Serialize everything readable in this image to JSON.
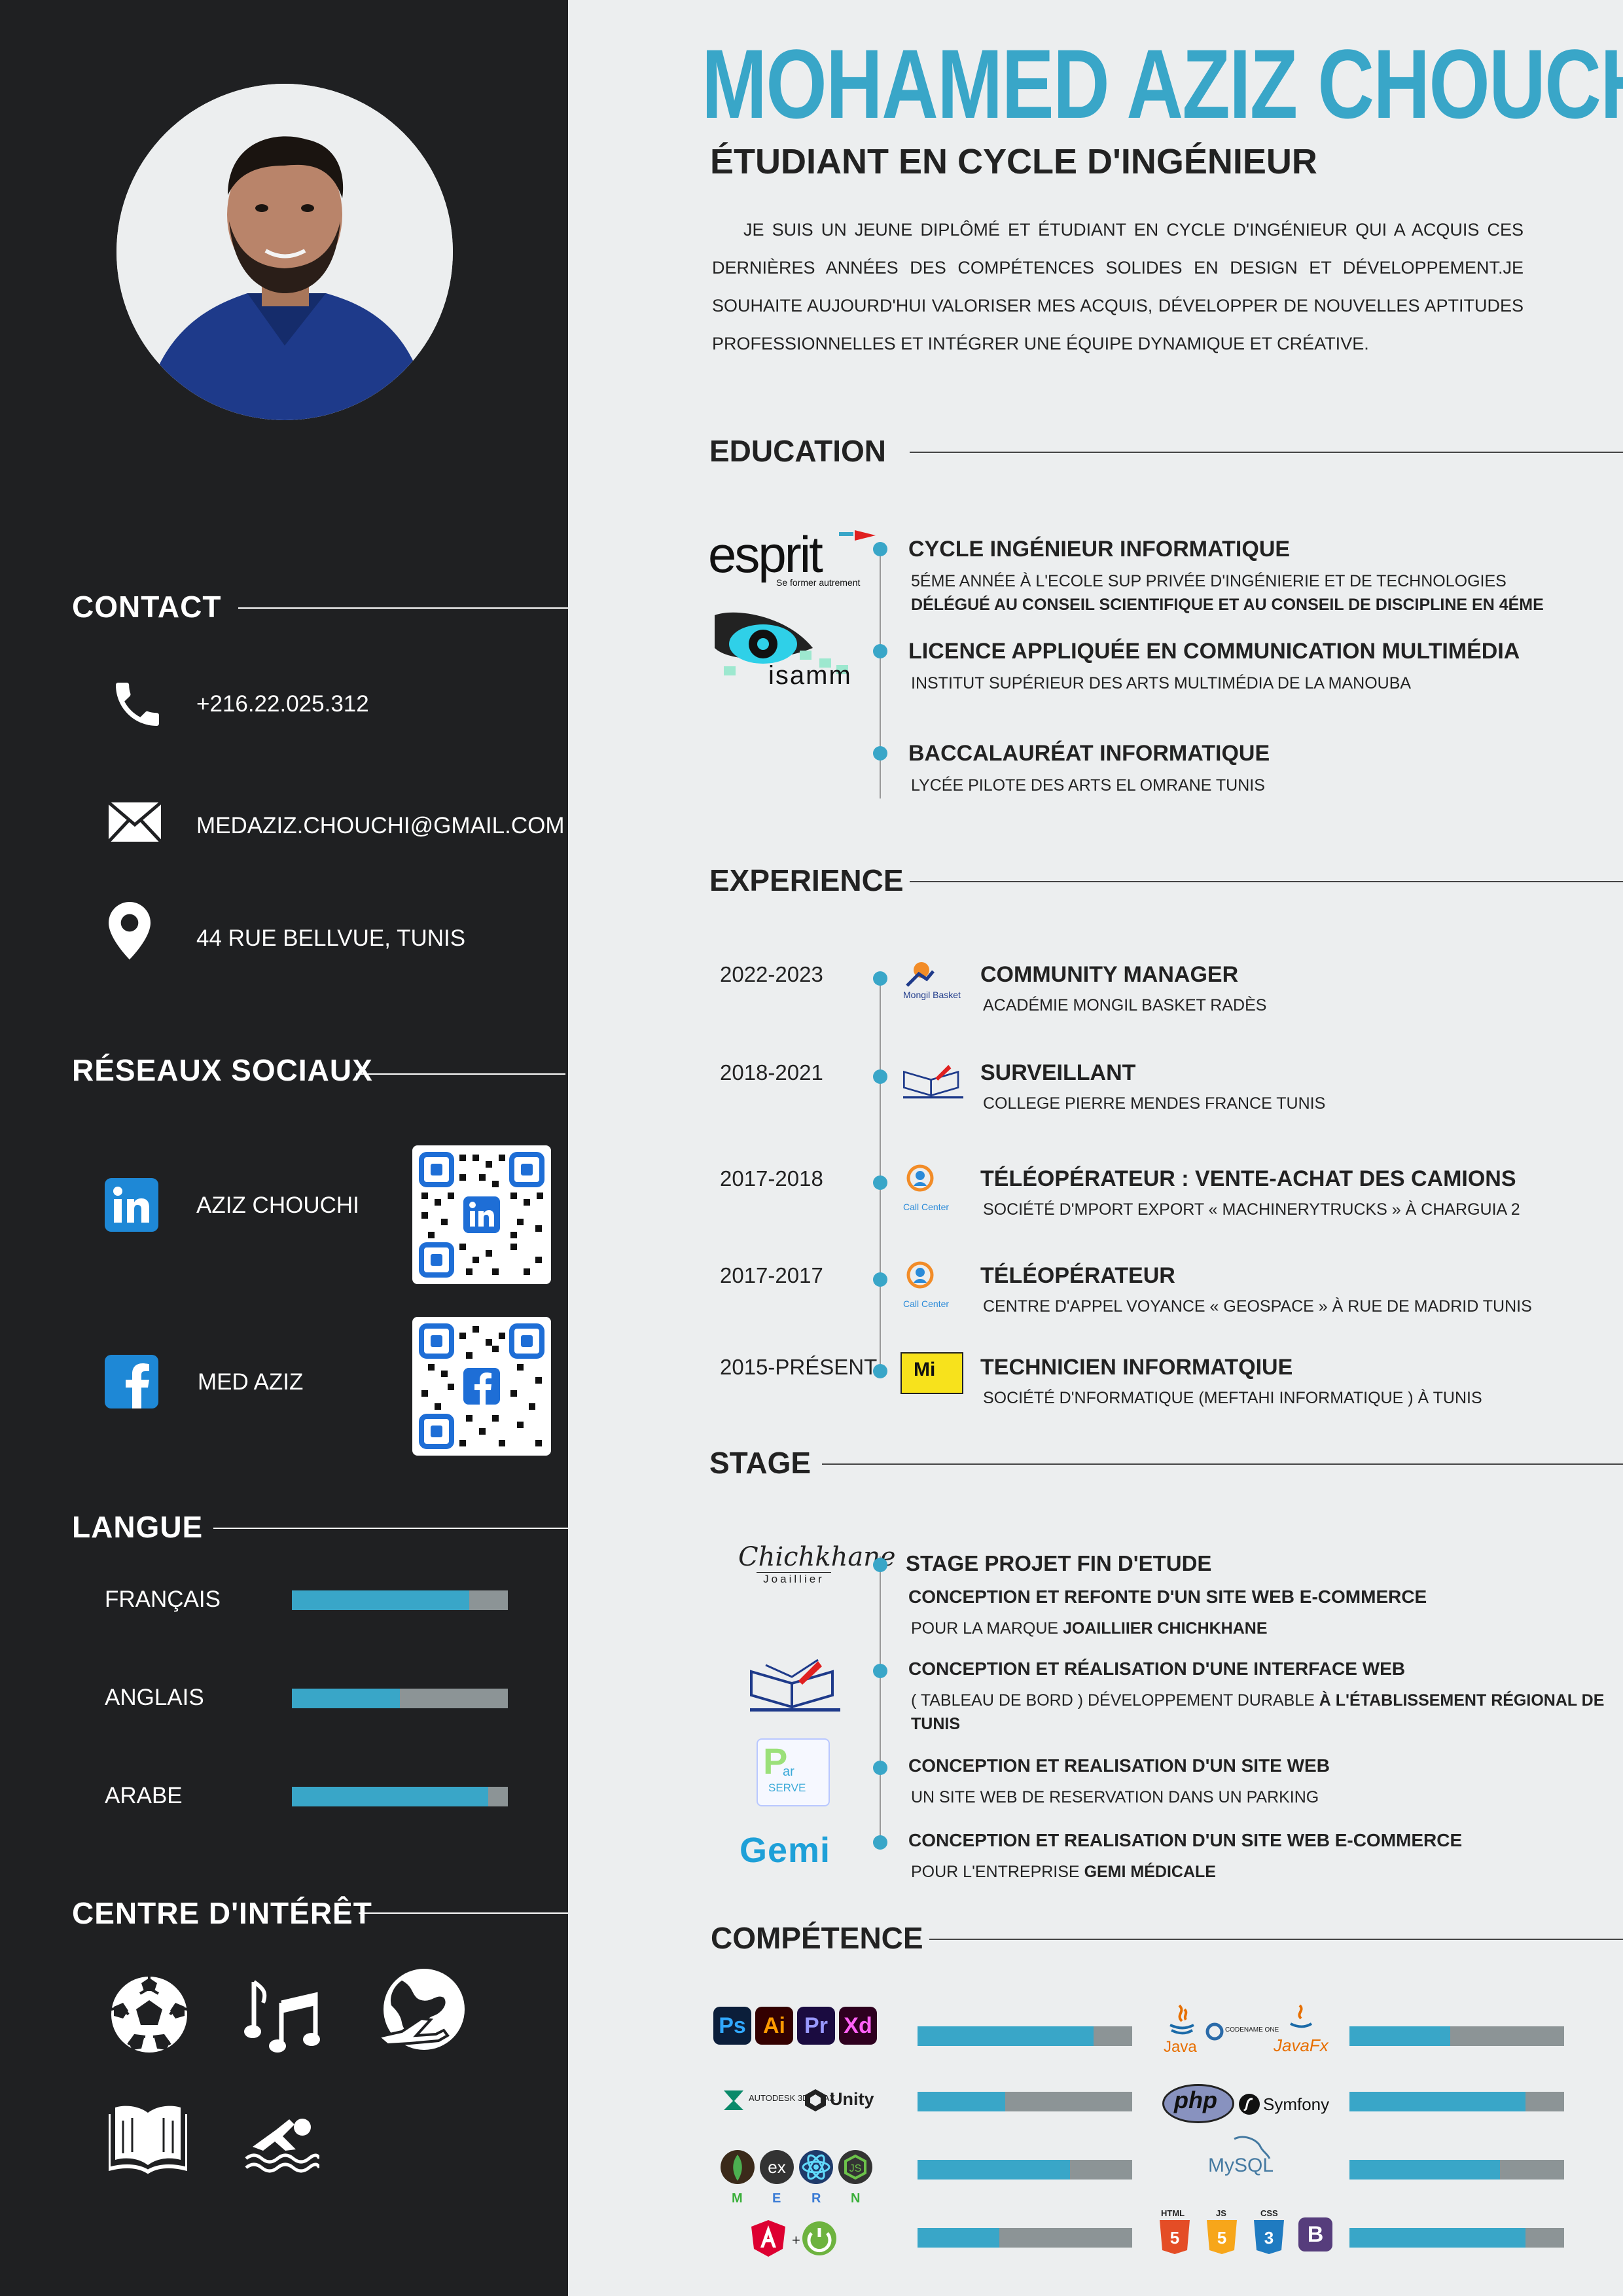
{
  "header": {
    "name": "MOHAMED AZIZ CHOUCHI",
    "subtitle": "ÉTUDIANT EN CYCLE D'INGÉNIEUR",
    "summary": "JE SUIS UN JEUNE DIPLÔMÉ ET ÉTUDIANT EN CYCLE D'INGÉNIEUR QUI A ACQUIS CES DERNIÈRES ANNÉES DES COMPÉTENCES SOLIDES EN DESIGN ET DÉVELOPPEMENT.JE SOUHAITE AUJOURD'HUI VALORISER MES ACQUIS, DÉVELOPPER DE NOUVELLES APTITUDES PROFESSIONNELLES ET INTÉGRER UNE ÉQUIPE DYNAMIQUE ET CRÉATIVE."
  },
  "colors": {
    "accent": "#39a6c8",
    "sidebar": "#1f2022",
    "bar_track": "#8c9496",
    "background": "#eceeef"
  },
  "contact": {
    "heading": "CONTACT",
    "phone": "+216.22.025.312",
    "email": "MEDAZIZ.CHOUCHI@GMAIL.COM",
    "address": "44 RUE BELLVUE, TUNIS",
    "icons": [
      "phone-icon",
      "mail-icon",
      "location-pin-icon"
    ]
  },
  "social": {
    "heading": "RÉSEAUX SOCIAUX",
    "linkedin": "AZIZ CHOUCHI",
    "facebook": "MED AZIZ"
  },
  "languages": {
    "heading": "LANGUE",
    "items": [
      {
        "label": "FRANÇAIS",
        "level": 0.82
      },
      {
        "label": "ANGLAIS",
        "level": 0.5
      },
      {
        "label": "ARABE",
        "level": 0.91
      }
    ]
  },
  "interests": {
    "heading": "CENTRE D'INTÉRÊT",
    "icons": [
      "football-icon",
      "music-icon",
      "travel-icon",
      "reading-icon",
      "swimming-icon"
    ]
  },
  "education": {
    "heading": "EDUCATION",
    "logos": {
      "esprit": "esprit",
      "esprit_tag": "Se former autrement",
      "isamm": "isamm"
    },
    "items": [
      {
        "title": "CYCLE INGÉNIEUR INFORMATIQUE",
        "line1": "5ÉME ANNÉE À L'ECOLE SUP PRIVÉE D'INGÉNIERIE ET DE TECHNOLOGIES",
        "line2": "DÉLÉGUÉ AU CONSEIL SCIENTIFIQUE ET AU CONSEIL DE DISCIPLINE EN 4ÉME"
      },
      {
        "title": "LICENCE APPLIQUÉE EN COMMUNICATION MULTIMÉDIA",
        "line1": "INSTITUT SUPÉRIEUR DES ARTS MULTIMÉDIA DE LA MANOUBA"
      },
      {
        "title": "BACCALAURÉAT INFORMATIQUE",
        "line1": "LYCÉE PILOTE DES ARTS EL OMRANE TUNIS"
      }
    ]
  },
  "experience": {
    "heading": "EXPERIENCE",
    "items": [
      {
        "year": "2022-2023",
        "title": "COMMUNITY MANAGER",
        "sub": "ACADÉMIE MONGIL BASKET RADÈS",
        "logo": "Mongil Basket"
      },
      {
        "year": "2018-2021",
        "title": "SURVEILLANT",
        "sub": "COLLEGE PIERRE MENDES FRANCE TUNIS",
        "logo": ""
      },
      {
        "year": "2017-2018",
        "title": "TÉLÉOPÉRATEUR : VENTE-ACHAT DES CAMIONS",
        "sub": "SOCIÉTÉ D'MPORT EXPORT « MACHINERYTRUCKS » À CHARGUIA 2",
        "logo": "Call Center"
      },
      {
        "year": "2017-2017",
        "title": "TÉLÉOPÉRATEUR",
        "sub": "CENTRE D'APPEL VOYANCE « GEOSPACE » À RUE DE MADRID TUNIS",
        "logo": "Call Center"
      },
      {
        "year": "2015-PRÉSENT",
        "title": "TECHNICIEN INFORMATQIUE",
        "sub": "SOCIÉTÉ D'NFORMATIQUE (MEFTAHI INFORMATIQUE ) À TUNIS",
        "logo": "Mi"
      }
    ]
  },
  "stage": {
    "heading": "STAGE",
    "logos": {
      "chichkhane": "Chichkhane",
      "chichkhane_sub": "Joaillier",
      "parserve_p": "P",
      "parserve_ar": "ar",
      "parserve_s": "SERVE",
      "gemi": "Gemi"
    },
    "items": [
      {
        "title": "STAGE PROJET FIN D'ETUDE",
        "bold": "CONCEPTION ET REFONTE D'UN SITE WEB E-COMMERCE",
        "sub": "POUR LA MARQUE ",
        "sub_bold": "JOAILLIIER CHICHKHANE"
      },
      {
        "bold": "CONCEPTION ET RÉALISATION D'UNE INTERFACE WEB",
        "sub": "( TABLEAU DE BORD ) DÉVELOPPEMENT DURABLE ",
        "sub_bold": "À L'ÉTABLISSEMENT RÉGIONAL DE",
        "sub_bold2": "TUNIS"
      },
      {
        "bold": "CONCEPTION ET REALISATION D'UN SITE WEB",
        "sub": "UN SITE WEB DE RESERVATION DANS UN PARKING"
      },
      {
        "bold": "CONCEPTION ET REALISATION D'UN SITE WEB E-COMMERCE",
        "sub": "POUR L'ENTREPRISE ",
        "sub_bold": "GEMI MÉDICALE"
      }
    ]
  },
  "skills": {
    "heading": "COMPÉTENCE",
    "left": [
      {
        "label": "Adobe Ps Ai Pr Xd",
        "badges": [
          "Ps",
          "Ai",
          "Pr",
          "Xd"
        ],
        "level": 0.82
      },
      {
        "label": "3DS MAX Unity",
        "tools": [
          "AUTODESK 3DS MAX",
          "Unity"
        ],
        "level": 0.41
      },
      {
        "label": "MERN",
        "letters": [
          "M",
          "E",
          "R",
          "N"
        ],
        "level": 0.71
      },
      {
        "label": "Angular Spring",
        "level": 0.38
      }
    ],
    "right": [
      {
        "label": "Java Codename One JavaFx",
        "tools": [
          "Java",
          "CODENAME ONE",
          "JavaFx"
        ],
        "level": 0.47
      },
      {
        "label": "PHP Symfony",
        "tools": [
          "php",
          "Symfony"
        ],
        "level": 0.82
      },
      {
        "label": "MySQL",
        "tools": [
          "MySQL"
        ],
        "level": 0.7
      },
      {
        "label": "HTML JS CSS Bootstrap",
        "tools": [
          "HTML",
          "JS",
          "CSS",
          "B"
        ],
        "level": 0.82
      }
    ]
  }
}
